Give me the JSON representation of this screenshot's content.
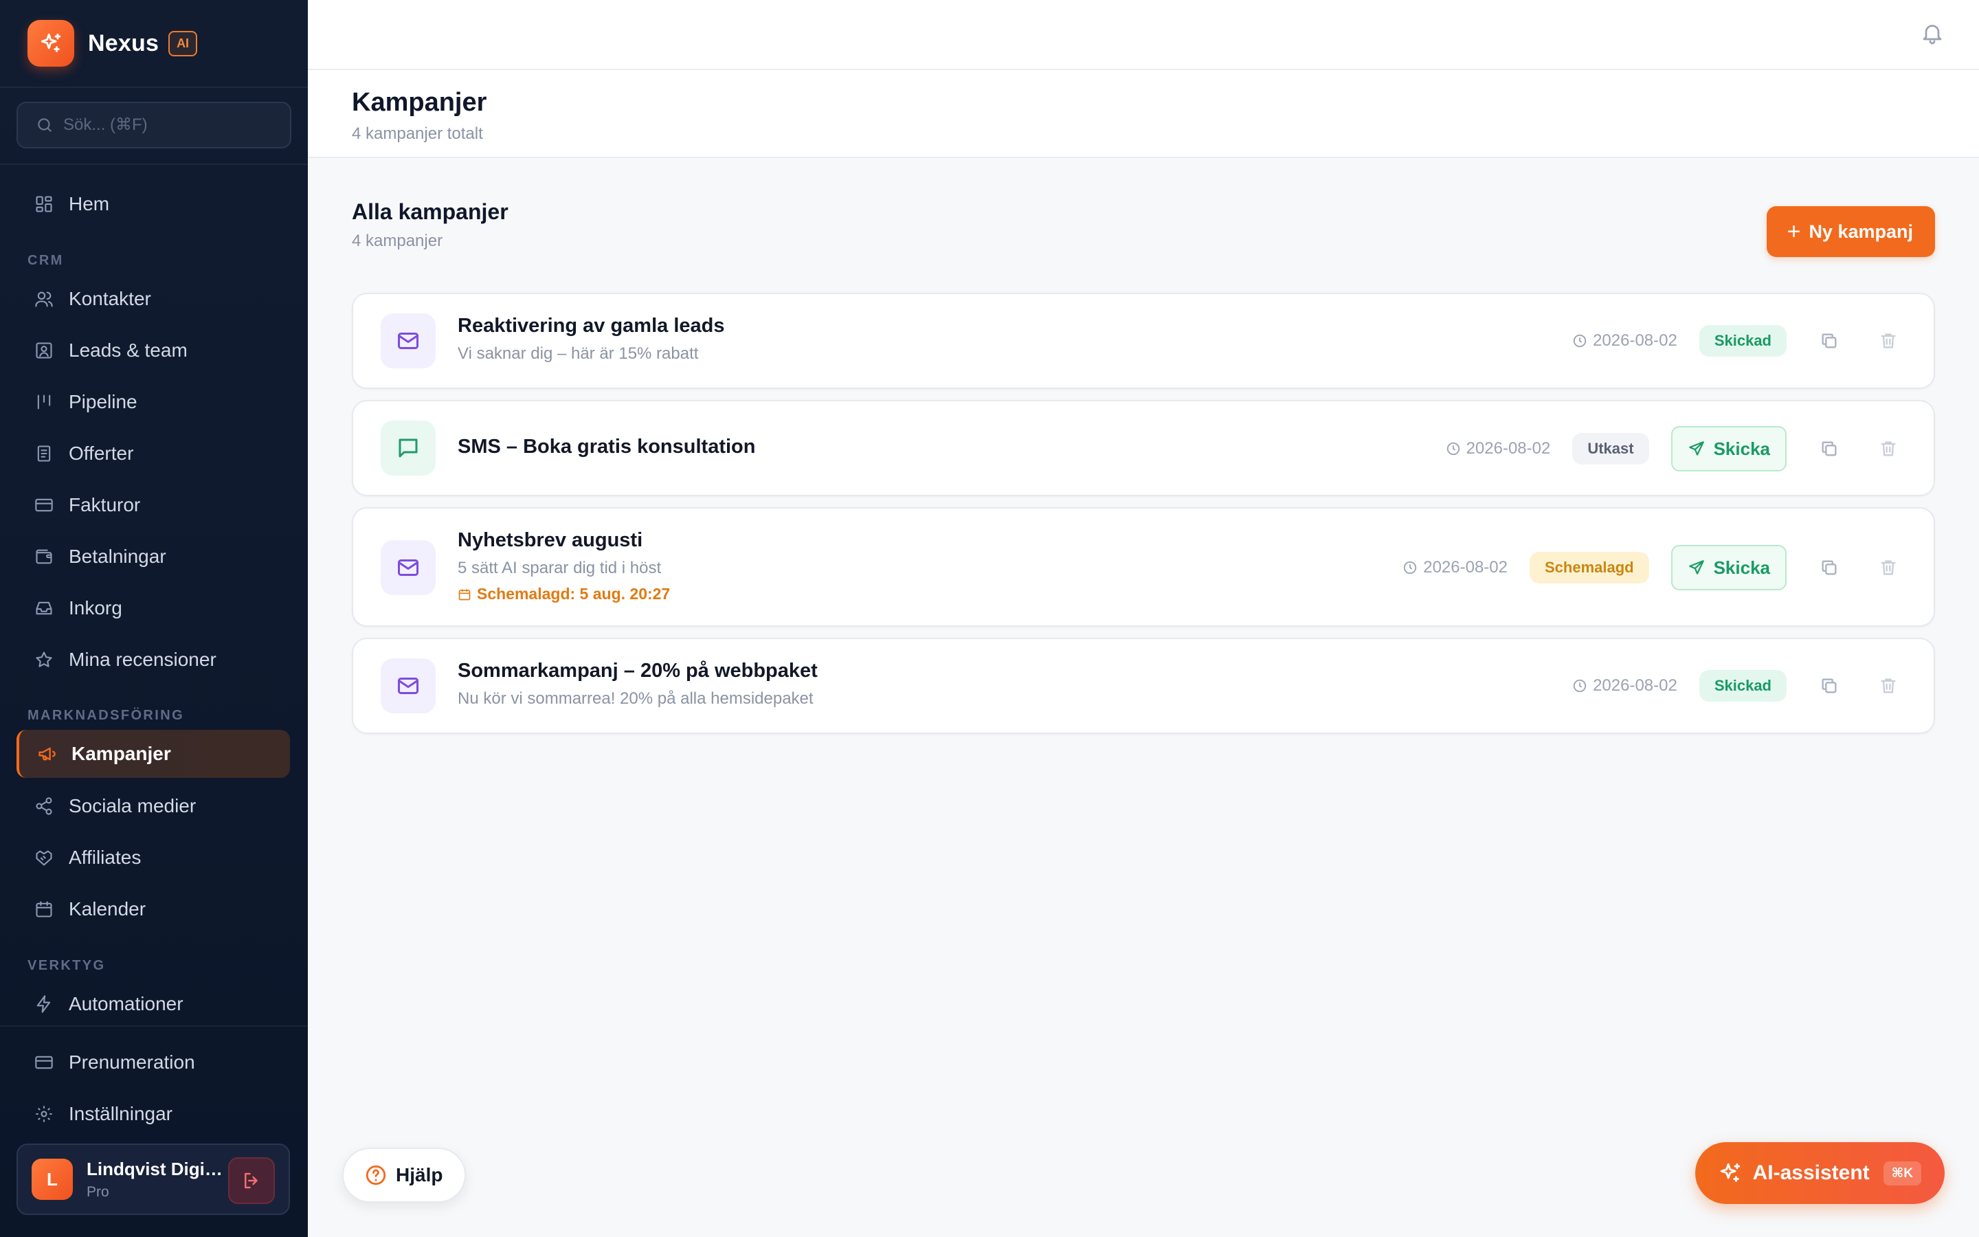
{
  "brand": {
    "name": "Nexus",
    "badge": "AI"
  },
  "search": {
    "placeholder": "Sök... (⌘F)"
  },
  "nav": {
    "home": "Hem",
    "sections": {
      "crm": "CRM",
      "marketing": "MARKNADSFÖRING",
      "tools": "VERKTYG"
    },
    "crm": [
      "Kontakter",
      "Leads & team",
      "Pipeline",
      "Offerter",
      "Fakturor",
      "Betalningar",
      "Inkorg",
      "Mina recensioner"
    ],
    "marketing": [
      "Kampanjer",
      "Sociala medier",
      "Affiliates",
      "Kalender"
    ],
    "tools": [
      "Automationer"
    ],
    "bottom": [
      "Prenumeration",
      "Inställningar"
    ],
    "active": "Kampanjer"
  },
  "user": {
    "initial": "L",
    "name": "Lindqvist Digit...",
    "plan": "Pro"
  },
  "header": {
    "title": "Kampanjer",
    "subtitle": "4 kampanjer totalt"
  },
  "section": {
    "title": "Alla kampanjer",
    "subtitle": "4 kampanjer",
    "new_button": "Ny kampanj"
  },
  "campaigns": [
    {
      "name": "Reaktivering av gamla leads",
      "subject": "Vi saknar dig – här är 15% rabatt",
      "channel": "email",
      "date": "2026-08-02",
      "status": "Skickad",
      "status_type": "sent",
      "schedule": "",
      "send_label": ""
    },
    {
      "name": "SMS – Boka gratis konsultation",
      "subject": "",
      "channel": "sms",
      "date": "2026-08-02",
      "status": "Utkast",
      "status_type": "draft",
      "schedule": "",
      "send_label": "Skicka"
    },
    {
      "name": "Nyhetsbrev augusti",
      "subject": "5 sätt AI sparar dig tid i höst",
      "channel": "email",
      "date": "2026-08-02",
      "status": "Schemalagd",
      "status_type": "scheduled",
      "schedule": "Schemalagd: 5 aug. 20:27",
      "send_label": "Skicka"
    },
    {
      "name": "Sommarkampanj – 20% på webbpaket",
      "subject": "Nu kör vi sommarrea! 20% på alla hemsidepaket",
      "channel": "email",
      "date": "2026-08-02",
      "status": "Skickad",
      "status_type": "sent",
      "schedule": "",
      "send_label": ""
    }
  ],
  "floating": {
    "help": "Hjälp",
    "ai": "AI-assistent",
    "ai_shortcut": "⌘K"
  },
  "colors": {
    "accent": "#f26a1d",
    "sidebar_bg": "#111c31",
    "sent": "#1a9a64",
    "scheduled": "#c98612"
  }
}
